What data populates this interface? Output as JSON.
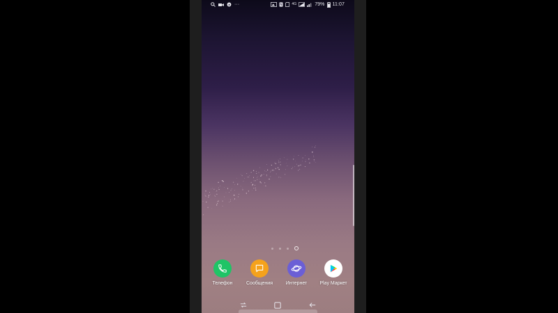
{
  "status_bar": {
    "battery_percent": "79%",
    "time": "11:07",
    "overflow": "···",
    "network_label": "4G"
  },
  "home_pages": {
    "count": 4,
    "active_index": 3
  },
  "dock": {
    "apps": [
      {
        "label": "Телефон",
        "icon": "phone-icon",
        "color": "#1fc466"
      },
      {
        "label": "Сообщения",
        "icon": "messages-icon",
        "color": "#f5a21c"
      },
      {
        "label": "Интернет",
        "icon": "internet-icon",
        "color": "#6b5fd6"
      },
      {
        "label": "Play Маркет",
        "icon": "play-store-icon",
        "color": "#ffffff"
      }
    ]
  },
  "nav_bar": {
    "buttons": [
      "recents-icon",
      "home-icon",
      "back-icon"
    ]
  }
}
